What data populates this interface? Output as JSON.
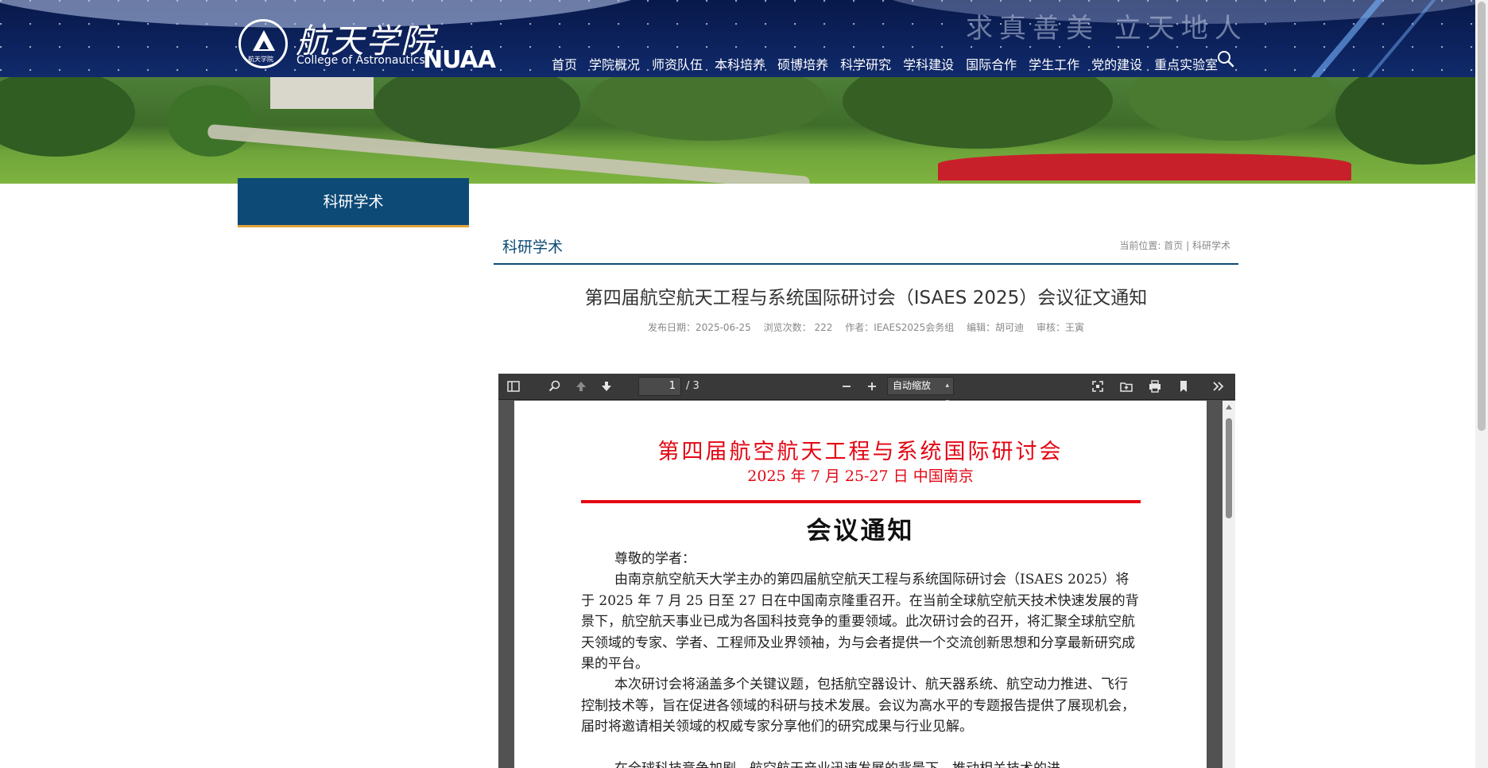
{
  "header": {
    "slogan": "求真善美  立天地人",
    "logo_cn": "航天学院",
    "logo_en": "College of Astronautics",
    "logo_brand": "NUAA",
    "logo_emblem_text": "航天学院",
    "nav": [
      "首页",
      "学院概况",
      "师资队伍",
      "本科培养",
      "硕博培养",
      "科学研究",
      "学科建设",
      "国际合作",
      "学生工作",
      "党的建设",
      "重点实验室"
    ]
  },
  "sidebar": {
    "title": "科研学术"
  },
  "section": {
    "title": "科研学术",
    "breadcrumb": {
      "prefix": "当前位置:",
      "home": "首页",
      "separator": "|",
      "current": "科研学术"
    }
  },
  "article": {
    "title": "第四届航空航天工程与系统国际研讨会（ISAES 2025）会议征文通知",
    "meta": {
      "date": "发布日期：2025-06-25",
      "views": "浏览次数：  222",
      "author": "作者：IEAES2025会务组",
      "editor": "编辑：胡可迪",
      "reviewer": "审核：王寅"
    }
  },
  "pdf": {
    "page_current": "1",
    "page_total": "/ 3",
    "zoom": "自动缩放",
    "doc_title": "第四届航空航天工程与系统国际研讨会",
    "doc_subtitle": "2025 年 7 月 25-27 日   中国南京",
    "doc_heading": "会议通知",
    "paragraphs": [
      "尊敬的学者：",
      "由南京航空航天大学主办的第四届航空航天工程与系统国际研讨会（ISAES 2025）将于 2025 年 7 月 25 日至 27 日在中国南京隆重召开。在当前全球航空航天技术快速发展的背景下，航空航天事业已成为各国科技竞争的重要领域。此次研讨会的召开，将汇聚全球航空航天领域的专家、学者、工程师及业界领袖，为与会者提供一个交流创新思想和分享最新研究成果的平台。",
      "本次研讨会将涵盖多个关键议题，包括航空器设计、航天器系统、航空动力推进、飞行控制技术等，旨在促进各领域的科研与技术发展。会议为高水平的专题报告提供了展现机会，届时将邀请相关领域的权威专家分享他们的研究成果与行业见解。",
      "在全球科技竞争加剧、航空航天产业迅速发展的背景下，推动相关技术的进"
    ]
  },
  "colors": {
    "primary": "#0d4a76",
    "accent": "#e2a23a",
    "doc_red": "#e30613",
    "header_bg": "#0a1f55"
  }
}
